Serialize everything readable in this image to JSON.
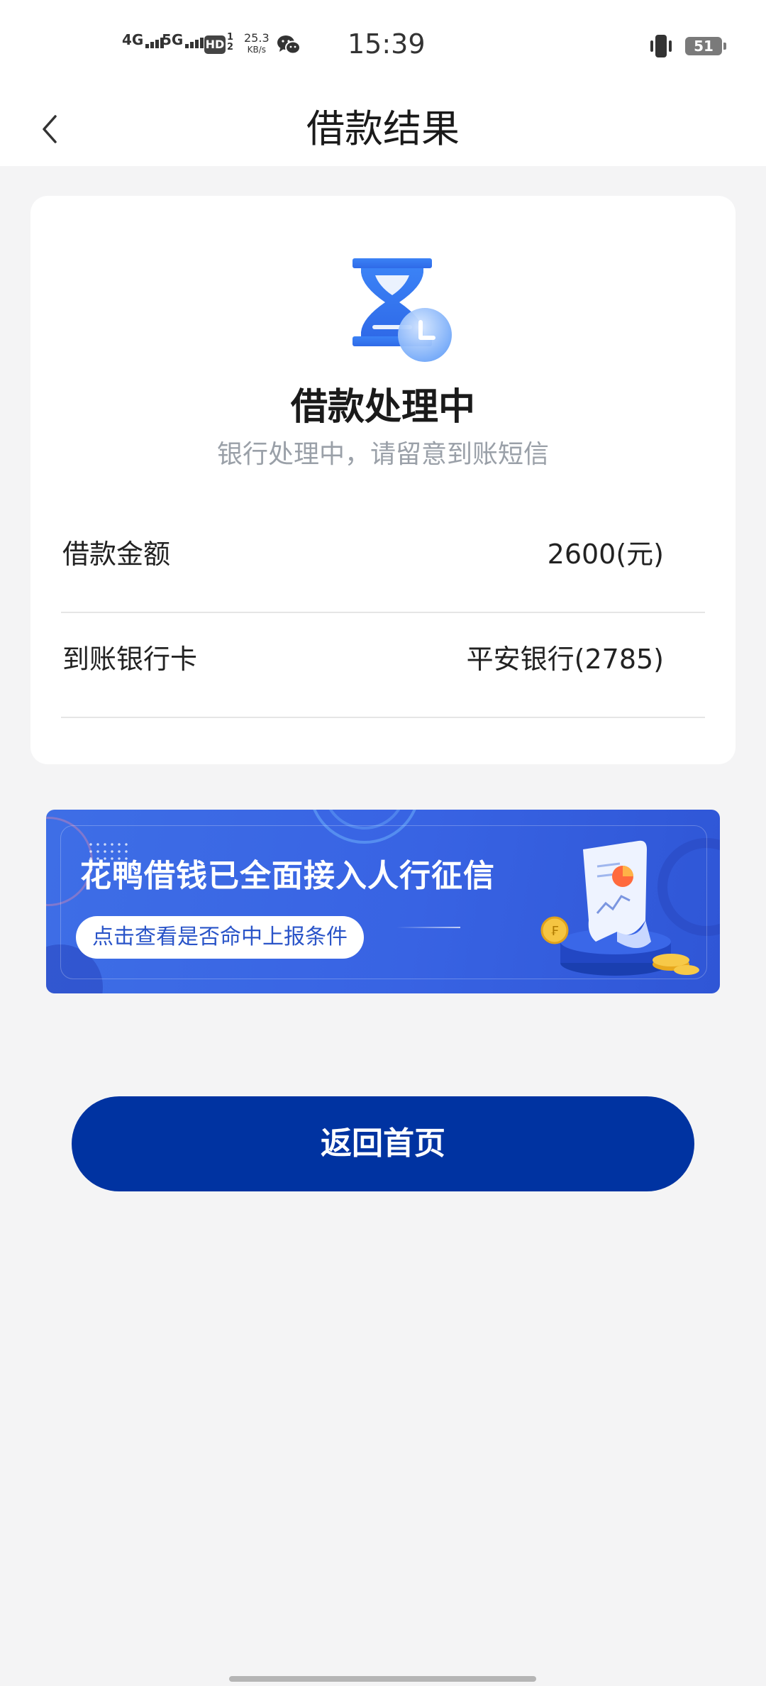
{
  "status_bar": {
    "net1": "4G",
    "net2": "5G",
    "hd": "HD",
    "hd_sub": "1 2",
    "speed_value": "25.3",
    "speed_unit": "KB/s",
    "time": "15:39",
    "battery": "51"
  },
  "header": {
    "title": "借款结果"
  },
  "result": {
    "status_title": "借款处理中",
    "status_subtitle": "银行处理中，请留意到账短信",
    "rows": [
      {
        "label": "借款金额",
        "value": "2600(元)"
      },
      {
        "label": "到账银行卡",
        "value": "平安银行(2785)"
      }
    ]
  },
  "banner": {
    "title": "花鸭借钱已全面接入人行征信",
    "button": "点击查看是否命中上报条件"
  },
  "actions": {
    "home_button": "返回首页"
  },
  "colors": {
    "primary_button": "#0033a1",
    "banner_blue": "#3863e3",
    "hourglass_blue": "#3b7bf0",
    "page_bg": "#f4f4f5"
  },
  "icons": [
    "back-arrow-icon",
    "hourglass-clock-icon",
    "wechat-icon",
    "vibrate-icon",
    "battery-icon",
    "signal-icon"
  ]
}
